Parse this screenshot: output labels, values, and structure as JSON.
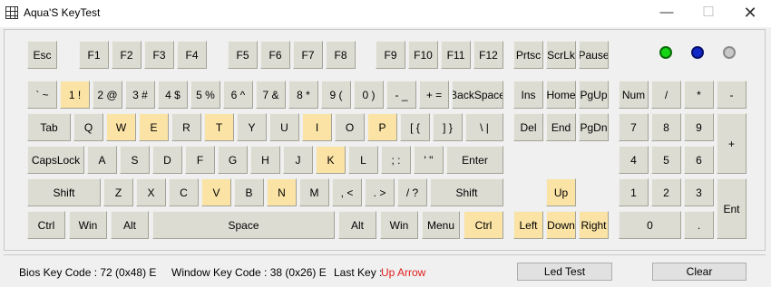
{
  "window": {
    "title": "Aqua'S KeyTest",
    "minimize_glyph": "—",
    "maximize_glyph": "☐",
    "close_glyph": "✕"
  },
  "keys": {
    "esc": "Esc",
    "f1": "F1",
    "f2": "F2",
    "f3": "F3",
    "f4": "F4",
    "f5": "F5",
    "f6": "F6",
    "f7": "F7",
    "f8": "F8",
    "f9": "F9",
    "f10": "F10",
    "f11": "F11",
    "f12": "F12",
    "prtsc": "Prtsc",
    "scrlk": "ScrLk",
    "pause": "Pause",
    "backtick": "` ~",
    "d1": "1 !",
    "d2": "2 @",
    "d3": "3 #",
    "d4": "4 $",
    "d5": "5 %",
    "d6": "6 ^",
    "d7": "7 &",
    "d8": "8 *",
    "d9": "9 (",
    "d0": "0 )",
    "minus": "- _",
    "equal": "+ =",
    "backspace": "BackSpace",
    "ins": "Ins",
    "home": "Home",
    "pgup": "PgUp",
    "numlock": "Num",
    "npdiv": "/",
    "npmul": "*",
    "npsub": "-",
    "tab": "Tab",
    "q": "Q",
    "w": "W",
    "e": "E",
    "r": "R",
    "t": "T",
    "y": "Y",
    "u": "U",
    "i": "I",
    "o": "O",
    "p": "P",
    "lbracket": "[ {",
    "rbracket": "] }",
    "backslash": "\\ |",
    "del": "Del",
    "end": "End",
    "pgdn": "PgDn",
    "np7": "7",
    "np8": "8",
    "np9": "9",
    "npadd": "+",
    "caps": "CapsLock",
    "a": "A",
    "s": "S",
    "d": "D",
    "f": "F",
    "g": "G",
    "h": "H",
    "j": "J",
    "k": "K",
    "l": "L",
    "semicolon": "; :",
    "quote": "' \"",
    "enter": "Enter",
    "np4": "4",
    "np5": "5",
    "np6": "6",
    "lshift": "Shift",
    "z": "Z",
    "x": "X",
    "c": "C",
    "v": "V",
    "b": "B",
    "n": "N",
    "m": "M",
    "comma": ", <",
    "period": ". >",
    "slash": "/ ?",
    "rshift": "Shift",
    "up": "Up",
    "np1": "1",
    "np2": "2",
    "np3": "3",
    "npenter": "Ent",
    "lctrl": "Ctrl",
    "lwin": "Win",
    "lalt": "Alt",
    "space": "Space",
    "ralt": "Alt",
    "rwin": "Win",
    "menu": "Menu",
    "rctrl": "Ctrl",
    "left": "Left",
    "down": "Down",
    "right": "Right",
    "np0": "0",
    "npdot": "."
  },
  "pressed_keys": [
    "d1",
    "w",
    "e",
    "t",
    "i",
    "p",
    "k",
    "v",
    "n",
    "rctrl",
    "up",
    "left",
    "down",
    "right"
  ],
  "leds": [
    "green",
    "blue",
    "gray"
  ],
  "status": {
    "bios_key_code": "Bios Key Code : 72 (0x48) E",
    "window_key_code": "Window Key Code : 38 (0x26) E",
    "last_key_label": "Last Key :",
    "last_key_value": "Up Arrow"
  },
  "buttons": {
    "led_test": "Led Test",
    "clear": "Clear"
  },
  "colors": {
    "key_normal": "#dcdcd3",
    "key_pressed": "#fae3a5",
    "last_key_text": "#e02020"
  }
}
